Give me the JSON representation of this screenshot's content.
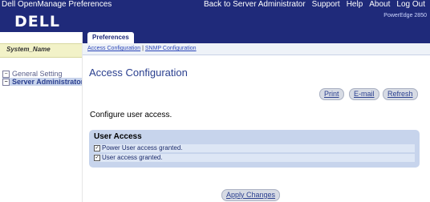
{
  "app": {
    "title": "Dell OpenManage Preferences",
    "logo": "DELL",
    "model": "PowerEdge 2850"
  },
  "topnav": [
    "Back to Server Administrator",
    "Support",
    "Help",
    "About",
    "Log Out"
  ],
  "left": {
    "system_name": "System_Name",
    "tree": [
      {
        "label": "General Setting",
        "toggle": "−",
        "selected": false
      },
      {
        "label": "Server Administrator",
        "toggle": "−",
        "selected": true
      }
    ]
  },
  "tabs": {
    "active": "Preferences",
    "subtabs": [
      "Access Configuration",
      "SNMP Configuration"
    ],
    "separator": "|"
  },
  "content": {
    "title": "Access Configuration",
    "buttons": {
      "print": "Print",
      "email": "E-mail",
      "refresh": "Refresh"
    },
    "instruction": "Configure user access.",
    "section": {
      "title": "User Access",
      "options": [
        {
          "label": "Power User access granted.",
          "checked": true
        },
        {
          "label": "User access granted.",
          "checked": true
        }
      ]
    },
    "apply_label": "Apply Changes"
  },
  "colors": {
    "header": "#1f2a7a",
    "section_bg": "#c7d4ec",
    "link": "#2b46b8",
    "title": "#2a3f8f"
  }
}
